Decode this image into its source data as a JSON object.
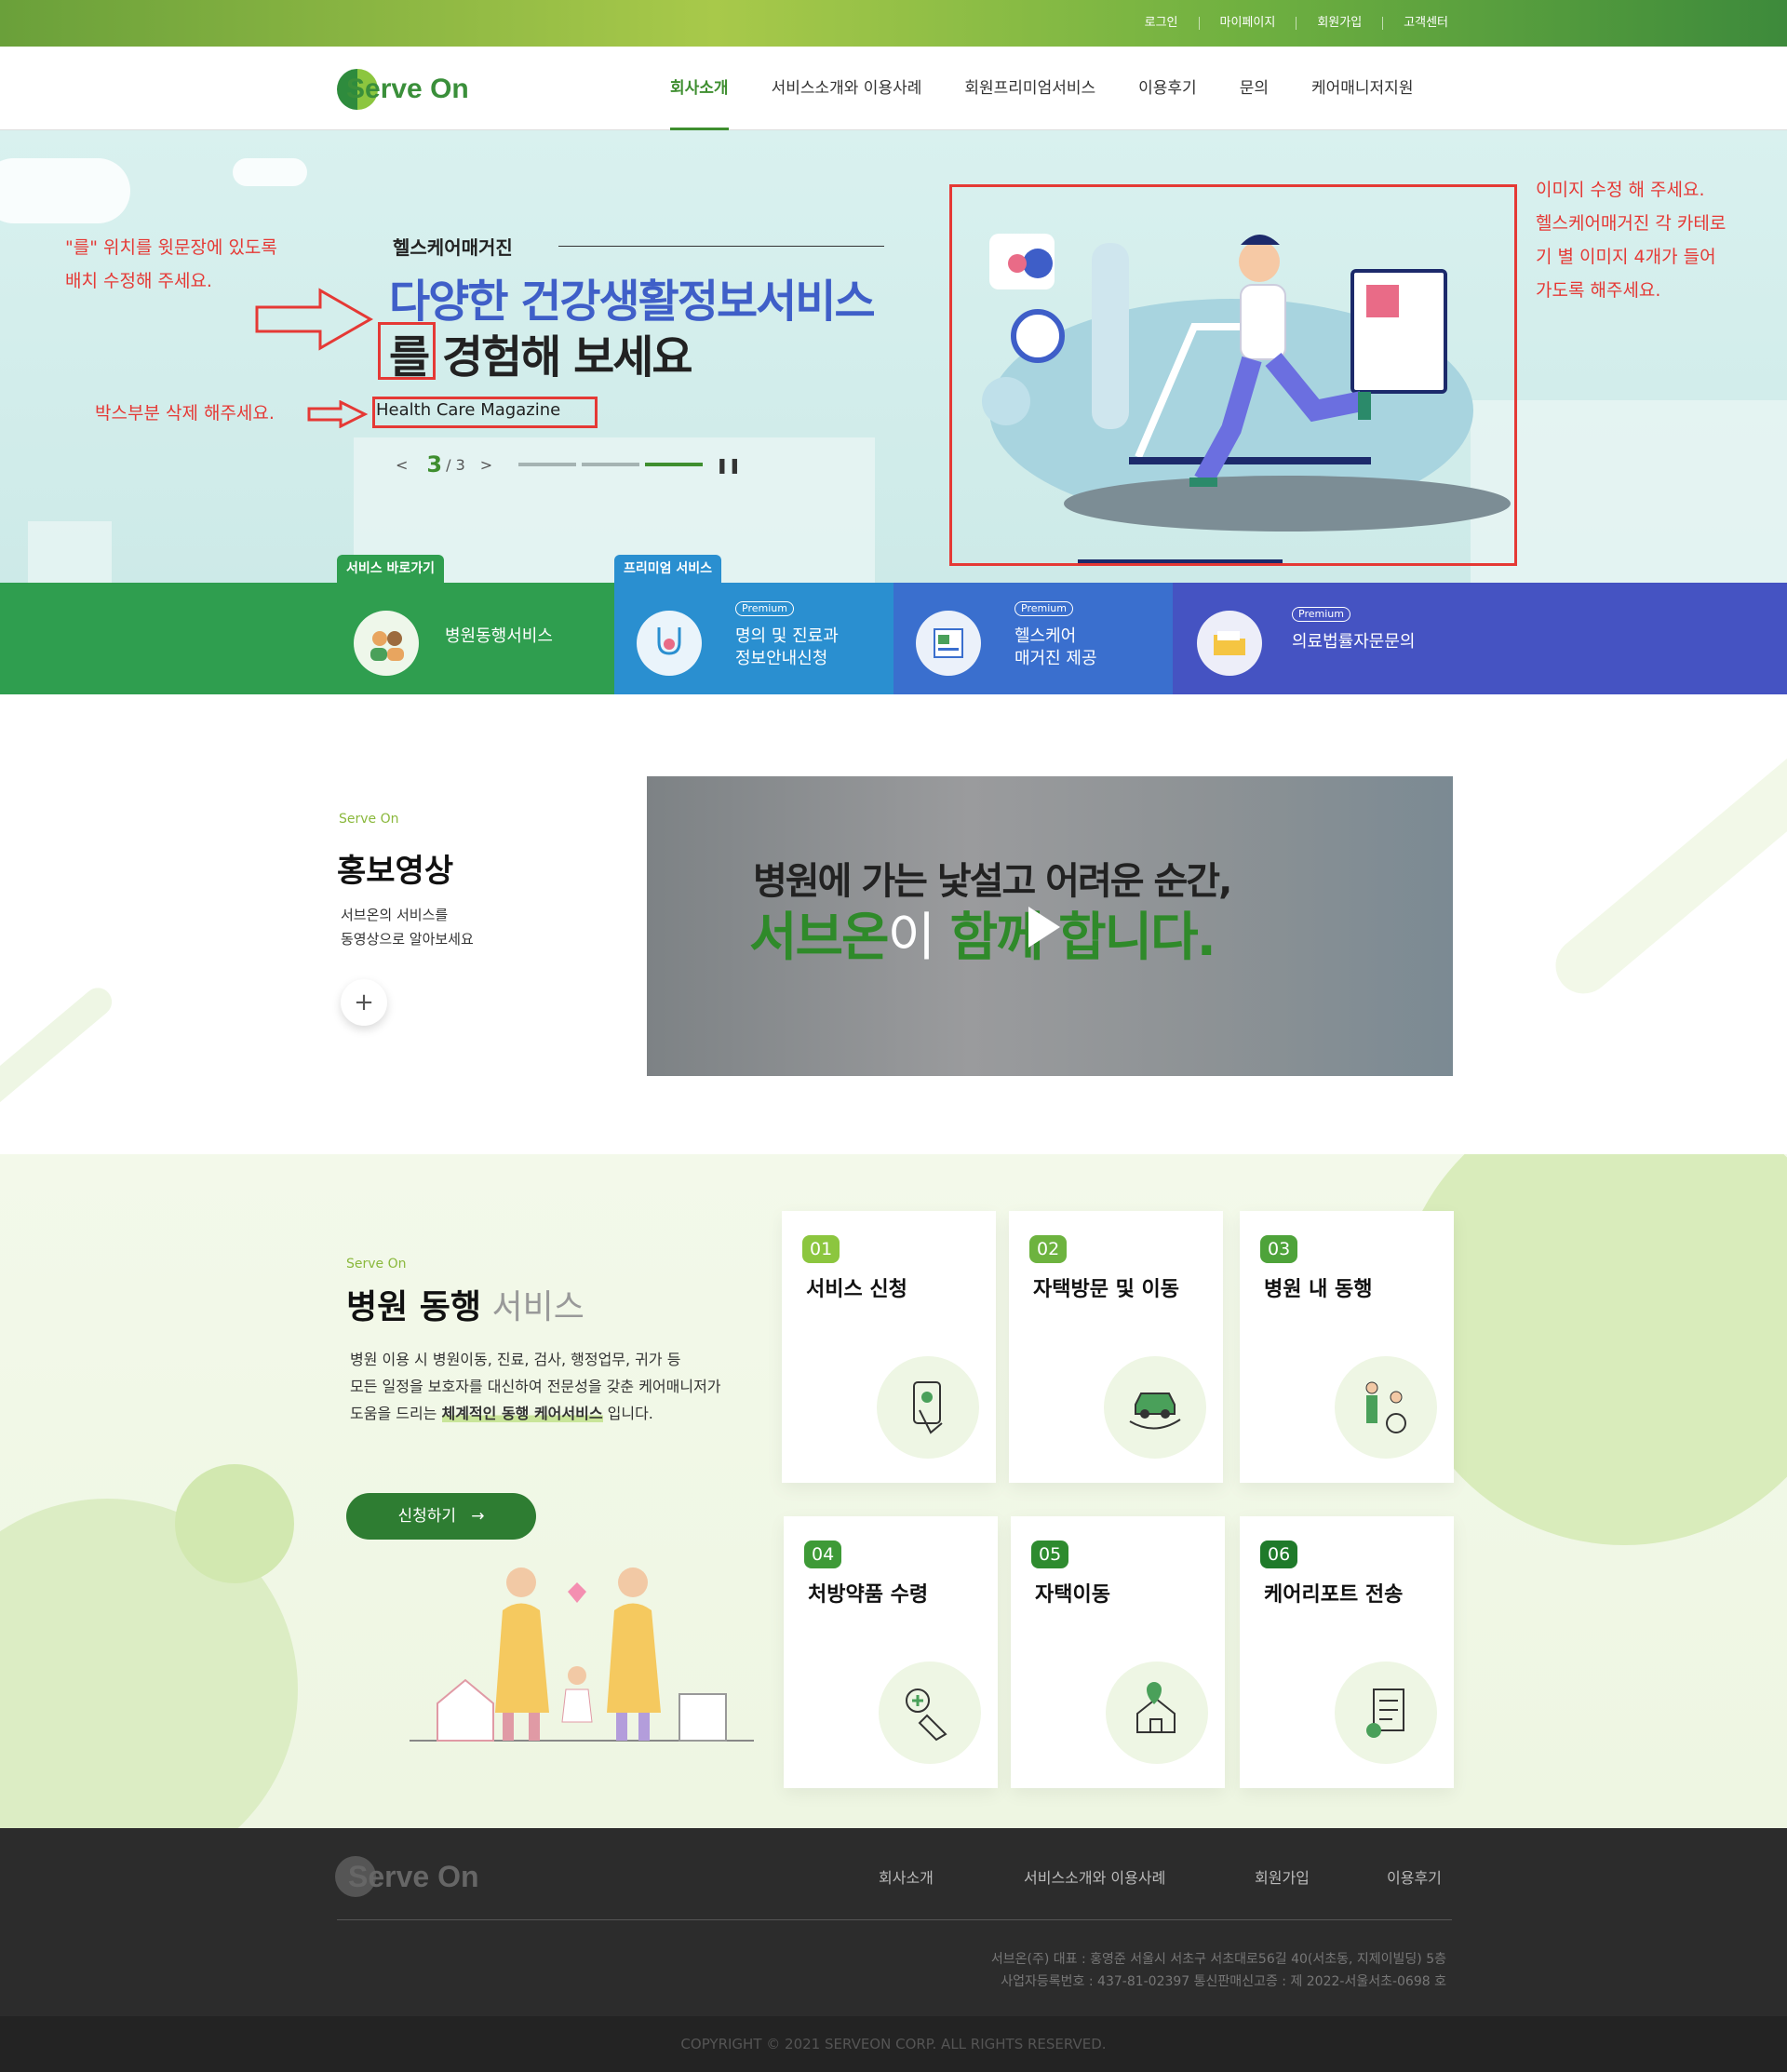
{
  "util": {
    "login": "로그인",
    "mypage": "마이페이지",
    "join": "회원가입",
    "support": "고객센터"
  },
  "brand": {
    "logo_text": "Serve On",
    "accent": "#3e8e2f",
    "secondary": "#8cc63f"
  },
  "nav": {
    "items": [
      "회사소개",
      "서비스소개와 이용사례",
      "회원프리미엄서비스",
      "이용후기",
      "문의",
      "케어매니저지원"
    ],
    "active_index": 0
  },
  "hero": {
    "annotation_left": "\"를\" 위치를 윗문장에 있도록\n배치 수정해 주세요.",
    "annotation_box": "박스부분 삭제 해주세요.",
    "annotation_right": "이미지 수정 해 주세요.\n헬스케어매거진 각 카테로\n기 별 이미지 4개가 들어\n가도록 해주세요.",
    "kicker": "헬스케어매거진",
    "headline_1": "다양한 건강생활정보서비스",
    "headline_2_a": "를",
    "headline_2_b": " 경험해 보세요",
    "tag": "Health Care Magazine",
    "slide_current": "3",
    "slide_total": "/ 3",
    "prev_icon": "chevron-left-icon",
    "next_icon": "chevron-right-icon",
    "pause_icon": "pause-icon",
    "slide_bar_count": 3,
    "slide_bar_active": 3
  },
  "quick": {
    "tab_shortcut": "서비스 바로가기",
    "tab_premium": "프리미엄 서비스",
    "premium_badge": "Premium",
    "items": [
      {
        "label": "병원동행서비스",
        "icon": "people-icon",
        "color": "#2f9e4f"
      },
      {
        "label": "명의 및 진료과\n정보안내신청",
        "icon": "stethoscope-icon",
        "color": "#2a8fd0"
      },
      {
        "label": "헬스케어\n매거진 제공",
        "icon": "magazine-icon",
        "color": "#3a6fce"
      },
      {
        "label": "의료법률자문문의",
        "icon": "folder-icon",
        "color": "#4553c2"
      }
    ]
  },
  "promo": {
    "sub": "Serve On",
    "title": "홍보영상",
    "desc": "서브온의 서비스를\n동영상으로 알아보세요",
    "more_icon": "plus-icon",
    "video_line1": "병원에 가는 낯설고 어려운 순간,",
    "video_line2_a": "서브온",
    "video_line2_b": "이",
    "video_line2_c": " 함께 합니다.",
    "play_icon": "play-icon"
  },
  "hospital": {
    "sub": "Serve On",
    "title_bold": "병원 동행",
    "title_light": " 서비스",
    "desc_1": "병원 이용 시 병원이동, 진료, 검사, 행정업무, 귀가 등",
    "desc_2": "모든 일정을 보호자를 대신하여 전문성을 갖춘 케어매니저가",
    "desc_3a": "도움을 드리는 ",
    "desc_3b": "체계적인 동행 케어서비스",
    "desc_3c": " 입니다.",
    "apply_label": "신청하기",
    "apply_arrow": "→",
    "cards": [
      {
        "num": "01",
        "name": "서비스 신청",
        "icon": "phone-touch-icon"
      },
      {
        "num": "02",
        "name": "자택방문 및 이동",
        "icon": "car-icon"
      },
      {
        "num": "03",
        "name": "병원 내 동행",
        "icon": "wheelchair-icon"
      },
      {
        "num": "04",
        "name": "처방약품 수령",
        "icon": "medicine-icon"
      },
      {
        "num": "05",
        "name": "자택이동",
        "icon": "home-location-icon"
      },
      {
        "num": "06",
        "name": "케어리포트 전송",
        "icon": "report-icon"
      }
    ]
  },
  "footer": {
    "logo_text": "Serve On",
    "menu": [
      "회사소개",
      "서비스소개와 이용사례",
      "회원가입",
      "이용후기"
    ],
    "info_1": "서브온(주) 대표 : 홍영준 서울시 서초구 서초대로56길 40(서초동, 지제이빌딩) 5층",
    "info_2": "사업자등록번호 : 437-81-02397  통신판매신고증 : 제 2022-서울서초-0698 호",
    "copyright": "COPYRIGHT © 2021 SERVEON CORP. ALL RIGHTS RESERVED."
  }
}
